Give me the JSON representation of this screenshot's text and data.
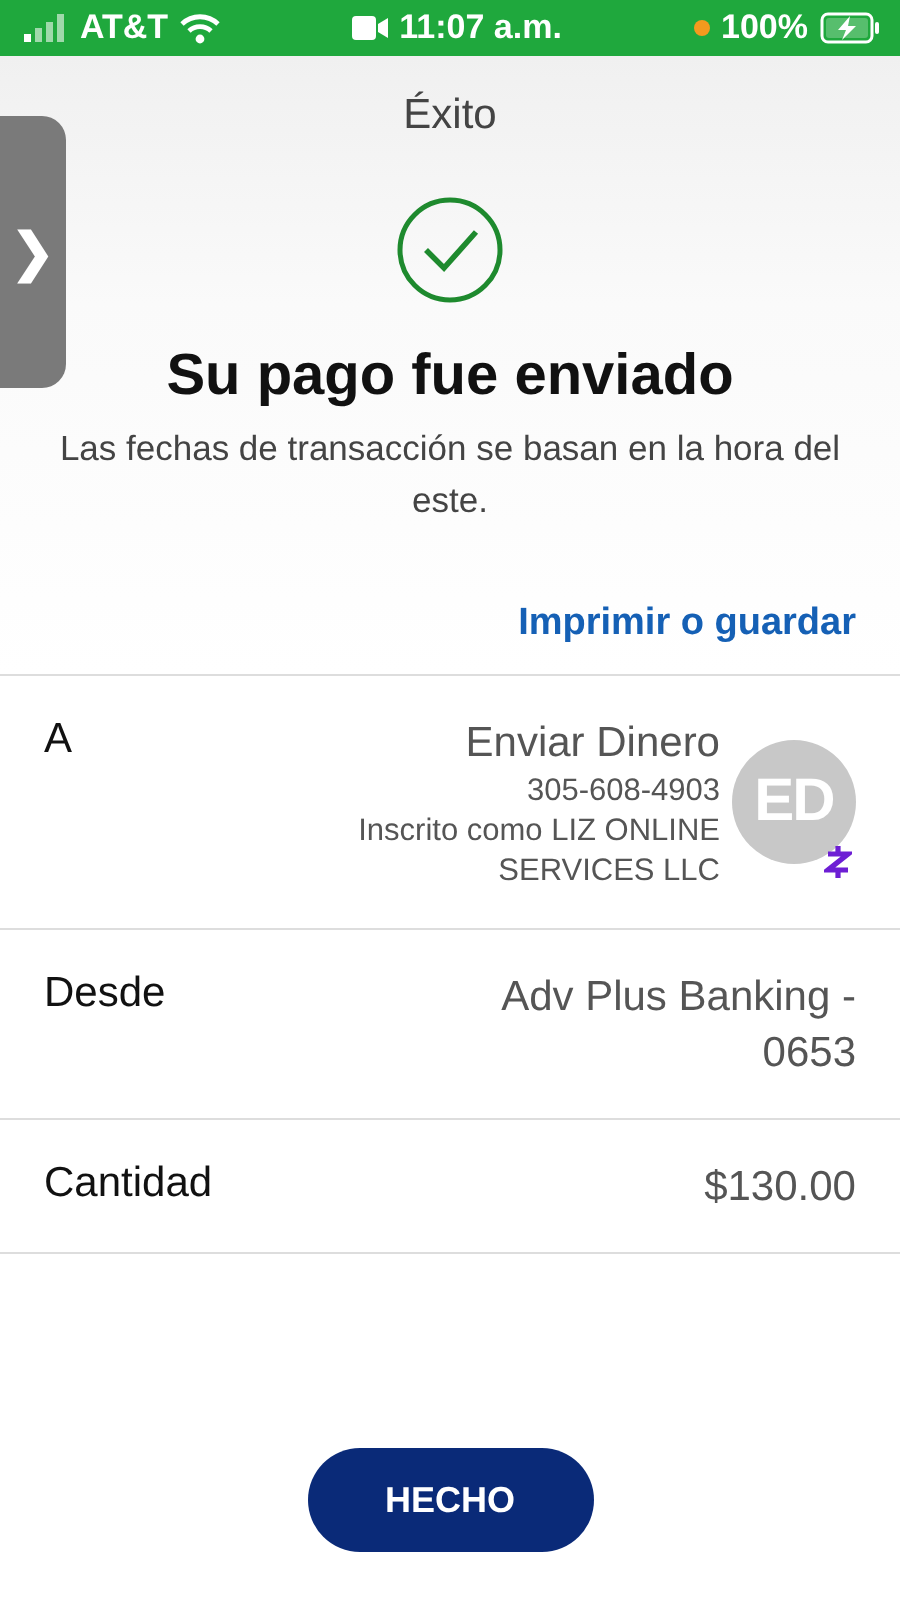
{
  "status_bar": {
    "carrier": "AT&T",
    "time": "11:07 a.m.",
    "battery": "100%",
    "charging": true
  },
  "header": {
    "title": "Éxito"
  },
  "side_tab": {
    "glyph": "❯"
  },
  "confirmation": {
    "heading": "Su pago fue enviado",
    "note": "Las fechas de transacción se basan en la hora del este.",
    "link": "Imprimir o guardar"
  },
  "details": [
    {
      "kind": "recipient",
      "label": "A",
      "name": "Enviar Dinero",
      "phone": "305-608-4903",
      "enrolled": "Inscrito como LIZ ONLINE SERVICES LLC",
      "initials": "ED"
    },
    {
      "kind": "plain",
      "label": "Desde",
      "value": "Adv Plus Banking - 0653"
    },
    {
      "kind": "plain",
      "label": "Cantidad",
      "value": "$130.00"
    }
  ],
  "done_button": "HECHO"
}
